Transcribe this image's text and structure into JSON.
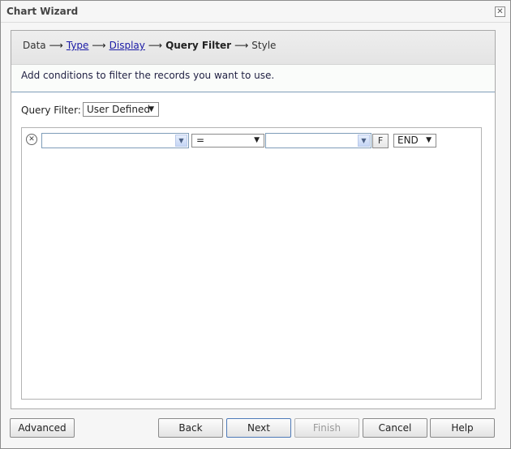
{
  "window": {
    "title": "Chart Wizard"
  },
  "steps": {
    "data": "Data",
    "type": "Type",
    "display": "Display",
    "query_filter": "Query Filter",
    "style": "Style"
  },
  "description": "Add conditions to filter the records you want to use.",
  "query_filter": {
    "label": "Query Filter:",
    "selected": "User Defined"
  },
  "condition": {
    "field_value": "",
    "operator": "=",
    "value": "",
    "function_button": "F",
    "logic": "END"
  },
  "buttons": {
    "advanced": "Advanced",
    "back": "Back",
    "next": "Next",
    "finish": "Finish",
    "cancel": "Cancel",
    "help": "Help"
  }
}
